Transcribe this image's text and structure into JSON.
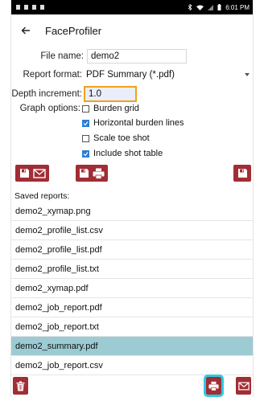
{
  "status_bar": {
    "time": "6:01 PM"
  },
  "app_bar": {
    "title": "FaceProfiler"
  },
  "form": {
    "file_name_label": "File name:",
    "file_name_value": "demo2",
    "report_format_label": "Report format:",
    "report_format_value": "PDF Summary (*.pdf)",
    "depth_increment_label": "Depth increment:",
    "depth_increment_value": "1.0",
    "graph_options_label": "Graph options:",
    "graph_options": [
      {
        "label": "Burden grid",
        "checked": false
      },
      {
        "label": "Horizontal burden lines",
        "checked": true
      },
      {
        "label": "Scale toe shot",
        "checked": false
      },
      {
        "label": "Include shot table",
        "checked": true
      }
    ]
  },
  "saved_reports": {
    "label": "Saved reports:",
    "items": [
      "demo2_xymap.png",
      "demo2_profile_list.csv",
      "demo2_profile_list.pdf",
      "demo2_profile_list.txt",
      "demo2_xymap.pdf",
      "demo2_job_report.pdf",
      "demo2_job_report.txt",
      "demo2_summary.pdf",
      "demo2_job_report.csv"
    ],
    "selected_index": 7
  },
  "colors": {
    "button": "#a12d35",
    "selected_row": "#9ccbd3",
    "focus": "#f0a21c",
    "print_highlight": "#2ecbe3"
  },
  "icons": [
    "back-arrow-icon",
    "save-icon",
    "email-icon",
    "print-icon",
    "trash-icon"
  ]
}
